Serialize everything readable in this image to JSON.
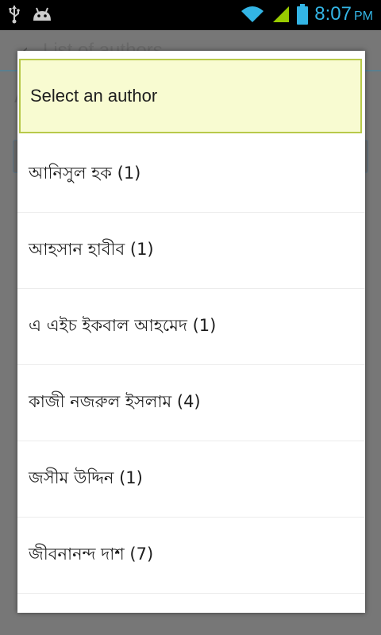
{
  "status_bar": {
    "time": "8:07",
    "ampm": "PM",
    "icons": [
      "usb-icon",
      "android-debug-icon",
      "wifi-icon",
      "signal-icon",
      "battery-icon"
    ],
    "accent_color": "#33b5e5"
  },
  "background_screen": {
    "title": "List of authors",
    "back_icon": "chevron-left-icon",
    "partial_letter": "A"
  },
  "dialog": {
    "title": "Select an author",
    "header_bg": "#f8fbd1",
    "header_border": "#b8c94a",
    "authors": [
      {
        "label": "আনিসুল হক (1)"
      },
      {
        "label": "আহসান হাবীব (1)"
      },
      {
        "label": "এ এইচ ইকবাল আহমেদ (1)"
      },
      {
        "label": "কাজী নজরুল ইসলাম (4)"
      },
      {
        "label": "জসীম উদ্দিন (1)"
      },
      {
        "label": "জীবনানন্দ দাশ (7)"
      }
    ]
  }
}
